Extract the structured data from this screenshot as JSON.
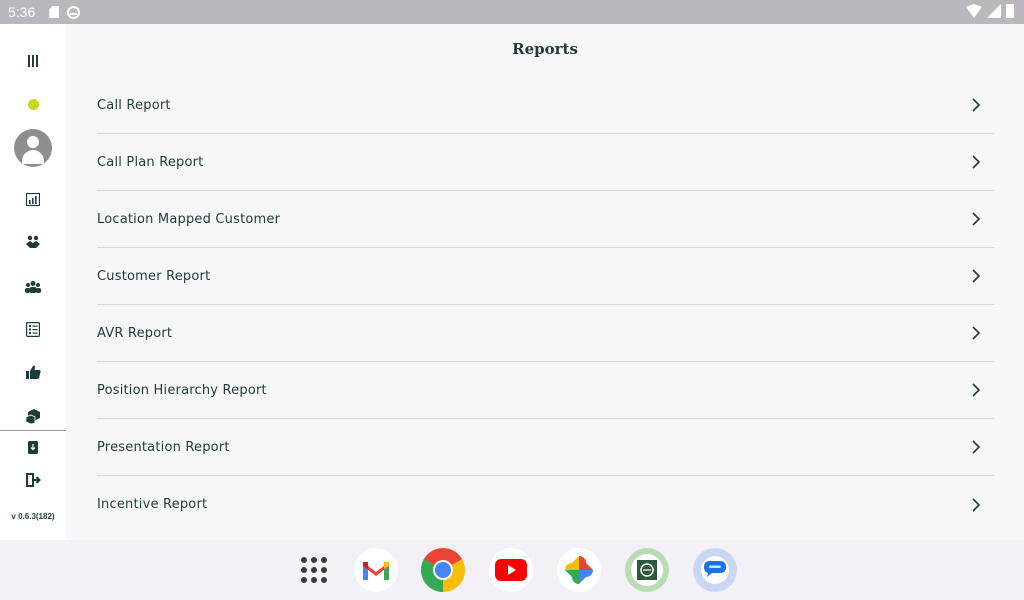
{
  "status_bar": {
    "time": "5:36"
  },
  "sidebar": {
    "version": "v 0.6.3(182)",
    "status_color": "#c8d81e",
    "icons": [
      "menu-icon",
      "status-dot",
      "avatar",
      "dashboard-icon",
      "handshake-icon",
      "team-icon",
      "checklist-icon",
      "thumbs-up-icon",
      "cubes-icon",
      "download-icon",
      "logout-icon"
    ]
  },
  "page": {
    "title": "Reports"
  },
  "reports": [
    {
      "label": "Call Report"
    },
    {
      "label": "Call Plan Report"
    },
    {
      "label": "Location Mapped Customer"
    },
    {
      "label": "Customer Report"
    },
    {
      "label": "AVR Report"
    },
    {
      "label": "Position Hierarchy Report"
    },
    {
      "label": "Presentation Report"
    },
    {
      "label": "Incentive Report"
    }
  ],
  "dock": {
    "apps": [
      "all-apps-icon",
      "gmail-icon",
      "chrome-icon",
      "youtube-icon",
      "photos-icon",
      "custom-app-icon",
      "messages-icon"
    ]
  },
  "colors": {
    "text": "#1f3b3a",
    "background": "#f7f6fb",
    "status_bar": "#bcb6bf"
  }
}
